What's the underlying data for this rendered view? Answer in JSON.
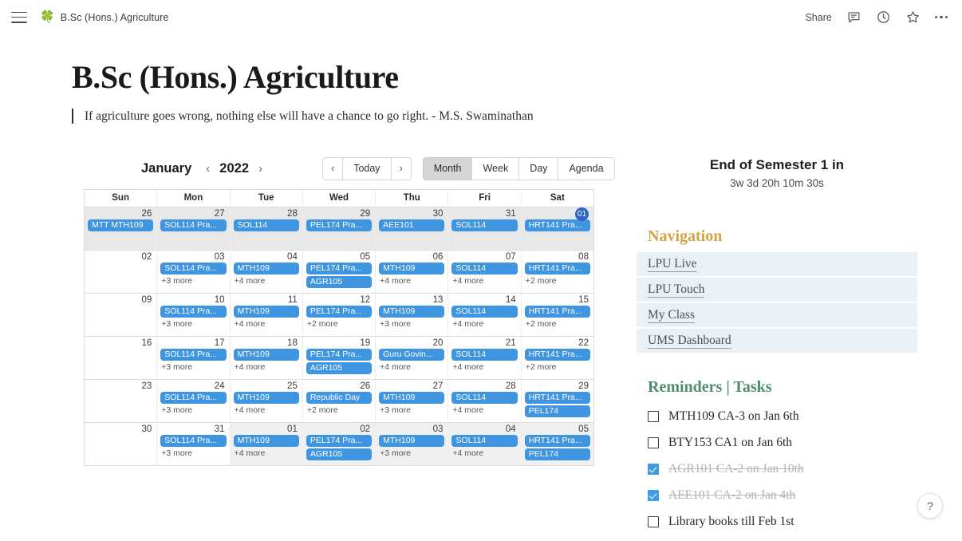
{
  "topbar": {
    "menu_icon": "hamburger-icon",
    "site_icon": "clover-icon",
    "site_title": "B.Sc (Hons.) Agriculture",
    "share_label": "Share",
    "comment_icon": "comment-icon",
    "history_icon": "clock-icon",
    "star_icon": "star-icon",
    "more_icon": "more-horizontal-icon"
  },
  "page": {
    "title": "B.Sc (Hons.) Agriculture",
    "quote": "If agriculture goes wrong, nothing else will have a chance to go right.  - M.S. Swaminathan"
  },
  "calendar": {
    "month": "January",
    "year": "2022",
    "prev_year_icon": "chevron-left-icon",
    "next_year_icon": "chevron-right-icon",
    "nav": {
      "prev": "‹",
      "today": "Today",
      "next": "›"
    },
    "views": [
      "Month",
      "Week",
      "Day",
      "Agenda"
    ],
    "active_view": "Month",
    "weekdays": [
      "Sun",
      "Mon",
      "Tue",
      "Wed",
      "Thu",
      "Fri",
      "Sat"
    ],
    "weeks": [
      {
        "other_month": true,
        "days": [
          {
            "num": "26",
            "events": [
              "MTT MTH109"
            ],
            "more": ""
          },
          {
            "num": "27",
            "events": [
              "SOL114 Pra..."
            ],
            "more": ""
          },
          {
            "num": "28",
            "events": [
              "SOL114"
            ],
            "more": ""
          },
          {
            "num": "29",
            "events": [
              "PEL174 Pra..."
            ],
            "more": ""
          },
          {
            "num": "30",
            "events": [
              "AEE101"
            ],
            "more": ""
          },
          {
            "num": "31",
            "events": [
              "SOL114"
            ],
            "more": ""
          },
          {
            "num": "01",
            "today": true,
            "events": [
              "HRT141 Pra..."
            ],
            "more": ""
          }
        ]
      },
      {
        "days": [
          {
            "num": "02",
            "events": [],
            "more": ""
          },
          {
            "num": "03",
            "events": [
              "SOL114 Pra..."
            ],
            "more": "+3 more"
          },
          {
            "num": "04",
            "events": [
              "MTH109"
            ],
            "more": "+4 more"
          },
          {
            "num": "05",
            "events": [
              "PEL174 Pra...",
              "AGR105"
            ],
            "more": ""
          },
          {
            "num": "06",
            "events": [
              "MTH109"
            ],
            "more": "+4 more"
          },
          {
            "num": "07",
            "events": [
              "SOL114"
            ],
            "more": "+4 more"
          },
          {
            "num": "08",
            "events": [
              "HRT141 Pra..."
            ],
            "more": "+2 more"
          }
        ]
      },
      {
        "days": [
          {
            "num": "09",
            "events": [],
            "more": ""
          },
          {
            "num": "10",
            "events": [
              "SOL114 Pra..."
            ],
            "more": "+3 more"
          },
          {
            "num": "11",
            "events": [
              "MTH109"
            ],
            "more": "+4 more"
          },
          {
            "num": "12",
            "events": [
              "PEL174 Pra..."
            ],
            "more": "+2 more"
          },
          {
            "num": "13",
            "events": [
              "MTH109"
            ],
            "more": "+3 more"
          },
          {
            "num": "14",
            "events": [
              "SOL114"
            ],
            "more": "+4 more"
          },
          {
            "num": "15",
            "events": [
              "HRT141 Pra..."
            ],
            "more": "+2 more"
          }
        ]
      },
      {
        "days": [
          {
            "num": "16",
            "events": [],
            "more": ""
          },
          {
            "num": "17",
            "events": [
              "SOL114 Pra..."
            ],
            "more": "+3 more"
          },
          {
            "num": "18",
            "events": [
              "MTH109"
            ],
            "more": "+4 more"
          },
          {
            "num": "19",
            "events": [
              "PEL174 Pra...",
              "AGR105"
            ],
            "more": ""
          },
          {
            "num": "20",
            "events": [
              "Guru Govin..."
            ],
            "more": "+4 more"
          },
          {
            "num": "21",
            "events": [
              "SOL114"
            ],
            "more": "+4 more"
          },
          {
            "num": "22",
            "events": [
              "HRT141 Pra..."
            ],
            "more": "+2 more"
          }
        ]
      },
      {
        "days": [
          {
            "num": "23",
            "events": [],
            "more": ""
          },
          {
            "num": "24",
            "events": [
              "SOL114 Pra..."
            ],
            "more": "+3 more"
          },
          {
            "num": "25",
            "events": [
              "MTH109"
            ],
            "more": "+4 more"
          },
          {
            "num": "26",
            "events": [
              "Republic Day"
            ],
            "more": "+2 more"
          },
          {
            "num": "27",
            "events": [
              "MTH109"
            ],
            "more": "+3 more"
          },
          {
            "num": "28",
            "events": [
              "SOL114"
            ],
            "more": "+4 more"
          },
          {
            "num": "29",
            "events": [
              "HRT141 Pra...",
              "PEL174"
            ],
            "more": ""
          }
        ]
      },
      {
        "partial_other": true,
        "days": [
          {
            "num": "30",
            "events": [],
            "more": ""
          },
          {
            "num": "31",
            "events": [
              "SOL114 Pra..."
            ],
            "more": "+3 more"
          },
          {
            "num": "01",
            "other": true,
            "events": [
              "MTH109"
            ],
            "more": "+4 more"
          },
          {
            "num": "02",
            "other": true,
            "events": [
              "PEL174 Pra...",
              "AGR105"
            ],
            "more": ""
          },
          {
            "num": "03",
            "other": true,
            "events": [
              "MTH109"
            ],
            "more": "+3 more"
          },
          {
            "num": "04",
            "other": true,
            "events": [
              "SOL114"
            ],
            "more": "+4 more"
          },
          {
            "num": "05",
            "other": true,
            "events": [
              "HRT141 Pra...",
              "PEL174"
            ],
            "more": ""
          }
        ]
      }
    ]
  },
  "sidebar": {
    "countdown_title": "End of Semester 1 in",
    "countdown_time": "3w 3d 20h 10m 30s",
    "navigation_title": "Navigation",
    "navigation_items": [
      {
        "label": "LPU Live"
      },
      {
        "label": "LPU Touch"
      },
      {
        "label": "My Class"
      },
      {
        "label": "UMS Dashboard"
      }
    ],
    "tasks_title": "Reminders | Tasks",
    "tasks": [
      {
        "label": "MTH109 CA-3 on Jan 6th",
        "done": false
      },
      {
        "label": "BTY153 CA1 on Jan 6th",
        "done": false
      },
      {
        "label": "AGR101 CA-2 on Jan 10th",
        "done": true
      },
      {
        "label": "AEE101 CA-2 on Jan 4th",
        "done": true
      },
      {
        "label": "Library books till Feb 1st",
        "done": false
      }
    ]
  },
  "help": {
    "label": "?",
    "icon": "question-mark-icon"
  },
  "colors": {
    "event_chip": "#3f95e0",
    "today_badge": "#2e65c8",
    "nav_heading": "#d3a245",
    "tasks_heading": "#4e8d6e",
    "nav_item_bg": "#e9f1f7",
    "checkbox_checked": "#3f9ce0"
  }
}
